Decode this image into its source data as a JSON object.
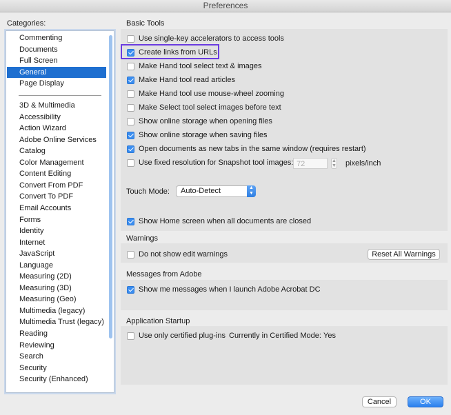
{
  "window": {
    "title": "Preferences"
  },
  "categories": {
    "label": "Categories:",
    "group1": [
      "Commenting",
      "Documents",
      "Full Screen",
      "General",
      "Page Display"
    ],
    "selected": "General",
    "group2": [
      "3D & Multimedia",
      "Accessibility",
      "Action Wizard",
      "Adobe Online Services",
      "Catalog",
      "Color Management",
      "Content Editing",
      "Convert From PDF",
      "Convert To PDF",
      "Email Accounts",
      "Forms",
      "Identity",
      "Internet",
      "JavaScript",
      "Language",
      "Measuring (2D)",
      "Measuring (3D)",
      "Measuring (Geo)",
      "Multimedia (legacy)",
      "Multimedia Trust (legacy)",
      "Reading",
      "Reviewing",
      "Search",
      "Security",
      "Security (Enhanced)"
    ]
  },
  "basic_tools": {
    "title": "Basic Tools",
    "options": [
      {
        "label": "Use single-key accelerators to access tools",
        "checked": false
      },
      {
        "label": "Create links from URLs",
        "checked": true
      },
      {
        "label": "Make Hand tool select text & images",
        "checked": false
      },
      {
        "label": "Make Hand tool read articles",
        "checked": true
      },
      {
        "label": "Make Hand tool use mouse-wheel zooming",
        "checked": false
      },
      {
        "label": "Make Select tool select images before text",
        "checked": false
      },
      {
        "label": "Show online storage when opening files",
        "checked": false
      },
      {
        "label": "Show online storage when saving files",
        "checked": true
      },
      {
        "label": "Open documents as new tabs in the same window (requires restart)",
        "checked": true
      },
      {
        "label": "Use fixed resolution for Snapshot tool images:",
        "checked": false
      }
    ],
    "resolution_placeholder": "72",
    "resolution_units": "pixels/inch",
    "touch_mode_label": "Touch Mode:",
    "touch_mode_value": "Auto-Detect",
    "home_screen": {
      "label": "Show Home screen when all documents are closed",
      "checked": true
    }
  },
  "warnings": {
    "title": "Warnings",
    "option": {
      "label": "Do not show edit warnings",
      "checked": false
    },
    "reset_button": "Reset All Warnings"
  },
  "messages": {
    "title": "Messages from Adobe",
    "option": {
      "label": "Show me messages when I launch Adobe Acrobat DC",
      "checked": true
    }
  },
  "startup": {
    "title": "Application Startup",
    "option": {
      "label": "Use only certified plug-ins",
      "checked": false
    },
    "mode_label": "Currently in Certified Mode:",
    "mode_value": "Yes"
  },
  "footer": {
    "cancel": "Cancel",
    "ok": "OK"
  },
  "colors": {
    "selection": "#1e6fd0",
    "checkbox_on": "#3b8ef0",
    "highlight": "#6a3be0"
  }
}
